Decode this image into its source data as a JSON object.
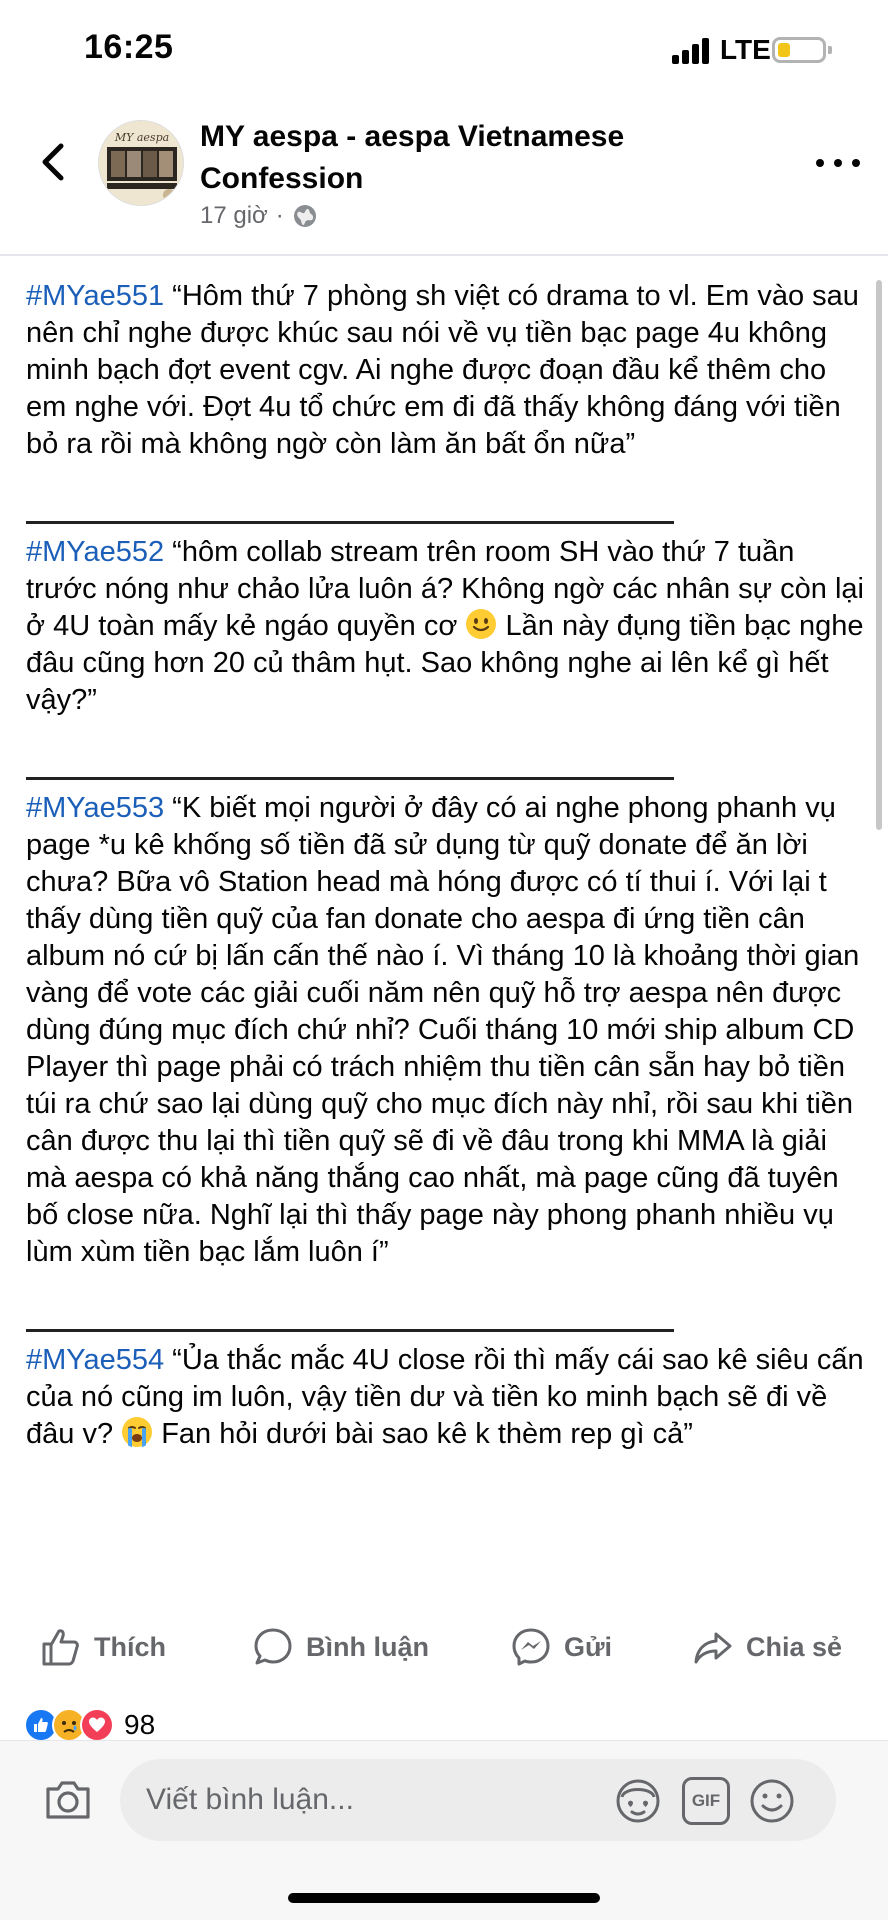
{
  "status": {
    "time": "16:25",
    "network": "LTE"
  },
  "header": {
    "group_name": "MY aespa - aespa Vietnamese Confession",
    "time_ago": "17 giờ",
    "separator": "·",
    "avatar_text": "MY aespa"
  },
  "post": {
    "entries": [
      {
        "tag": "#MYae551",
        "text": " “Hôm thứ 7 phòng sh việt có drama to vl. Em vào sau nên chỉ nghe được khúc sau nói về vụ tiền bạc page 4u không minh bạch đợt event cgv. Ai nghe được đoạn đầu kể thêm cho em nghe với. Đợt 4u tổ chức em đi đã thấy không đáng với tiền bỏ ra rồi mà không ngờ còn làm ăn bất ổn nữa”"
      },
      {
        "tag": "#MYae552",
        "text": " “hôm collab stream trên room SH vào thứ 7 tuần trước nóng như chảo lửa luôn á? Không ngờ các nhân sự còn lại ở 4U toàn mấy kẻ ngáo quyền cơ",
        "text_after": " Lần này đụng tiền bạc nghe đâu cũng hơn 20 củ thâm hụt. Sao không nghe ai lên kể gì hết vậy?”"
      },
      {
        "tag": "#MYae553",
        "text": " “K biết mọi người ở đây có ai nghe phong phanh vụ page *u kê khống số tiền đã sử dụng từ quỹ donate để ăn lời chưa? Bữa vô Station head mà hóng được có tí thui í. Với lại t thấy dùng tiền quỹ của fan donate cho aespa đi ứng tiền cân album nó cứ bị lấn cấn thế nào í. Vì tháng 10 là khoảng thời gian vàng để vote các giải cuối năm nên quỹ hỗ trợ aespa nên được dùng đúng mục đích chứ nhỉ? Cuối tháng 10 mới ship album CD Player thì page phải có trách nhiệm thu tiền cân sẵn hay bỏ tiền túi ra chứ sao lại dùng quỹ cho mục đích này nhỉ, rồi sau khi tiền cân được thu lại thì tiền quỹ sẽ đi về đâu trong khi MMA là giải mà aespa có khả năng thắng cao nhất, mà page cũng đã tuyên bố close nữa. Nghĩ lại thì thấy page này phong phanh nhiều vụ lùm xùm tiền bạc lắm luôn í”"
      },
      {
        "tag": "#MYae554",
        "text": " “Ủa thắc mắc 4U close rồi thì mấy cái sao kê siêu cấn của nó cũng im luôn, vậy tiền dư và tiền ko minh bạch sẽ đi về đâu v?",
        "text_after": " Fan hỏi dưới bài sao kê k thèm rep gì cả”"
      }
    ],
    "emoji_slight_smile": "slightly-smiling-face-emoji",
    "emoji_crying": "loudly-crying-face-emoji"
  },
  "actions": {
    "like": "Thích",
    "comment": "Bình luận",
    "send": "Gửi",
    "share": "Chia sẻ"
  },
  "reactions": {
    "types": [
      "like-icon",
      "sad-icon",
      "love-icon"
    ],
    "count": "98"
  },
  "composer": {
    "placeholder": "Viết bình luận...",
    "gif_label": "GIF"
  },
  "colors": {
    "hashtag": "#1b5fb8",
    "like_blue": "#1877f2",
    "love_red": "#f33e58",
    "sad_yellow": "#f7b125",
    "secondary_text": "#65676b"
  }
}
